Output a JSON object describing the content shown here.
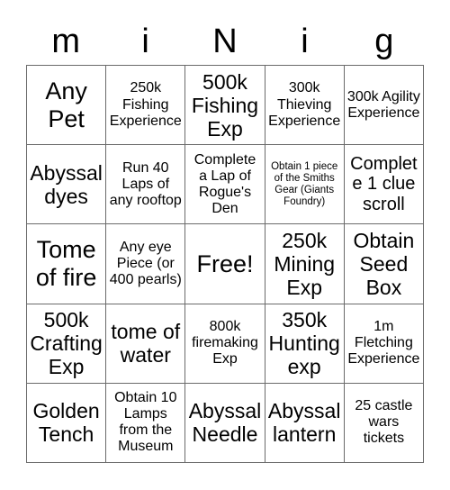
{
  "header": {
    "letters": [
      "m",
      "i",
      "N",
      "i",
      "g"
    ]
  },
  "colors": {
    "background": "#ffffff",
    "text": "#000000",
    "grid_line": "#6b6b6b"
  },
  "grid": {
    "columns": 5,
    "rows": 5,
    "cells": [
      [
        {
          "text": "Any Pet",
          "size": "s-xxl"
        },
        {
          "text": "250k Fishing Experience",
          "size": "s-md"
        },
        {
          "text": "500k Fishing Exp",
          "size": "s-xl"
        },
        {
          "text": "300k Thieving Experience",
          "size": "s-md"
        },
        {
          "text": "300k Agility Experience",
          "size": "s-md"
        }
      ],
      [
        {
          "text": "Abyssal dyes",
          "size": "s-xl"
        },
        {
          "text": "Run 40 Laps of any rooftop",
          "size": "s-md"
        },
        {
          "text": "Complete a Lap of Rogue's Den",
          "size": "s-md"
        },
        {
          "text": "Obtain 1 piece of the Smiths Gear (Giants Foundry)",
          "size": "s-xs"
        },
        {
          "text": "Complete 1 clue scroll",
          "size": "s-lg"
        }
      ],
      [
        {
          "text": "Tome of fire",
          "size": "s-xxl"
        },
        {
          "text": "Any eye Piece (or 400 pearls)",
          "size": "s-md"
        },
        {
          "text": "Free!",
          "size": "s-xxl"
        },
        {
          "text": "250k Mining Exp",
          "size": "s-xl"
        },
        {
          "text": "Obtain Seed Box",
          "size": "s-xl"
        }
      ],
      [
        {
          "text": "500k Crafting Exp",
          "size": "s-xl"
        },
        {
          "text": "tome of water",
          "size": "s-xl"
        },
        {
          "text": "800k firemaking Exp",
          "size": "s-md"
        },
        {
          "text": "350k Hunting exp",
          "size": "s-xl"
        },
        {
          "text": "1m Fletching Experience",
          "size": "s-md"
        }
      ],
      [
        {
          "text": "Golden Tench",
          "size": "s-xl"
        },
        {
          "text": "Obtain 10 Lamps from the Museum",
          "size": "s-md"
        },
        {
          "text": "Abyssal Needle",
          "size": "s-xl"
        },
        {
          "text": "Abyssal lantern",
          "size": "s-xl"
        },
        {
          "text": "25 castle wars tickets",
          "size": "s-md"
        }
      ]
    ]
  }
}
